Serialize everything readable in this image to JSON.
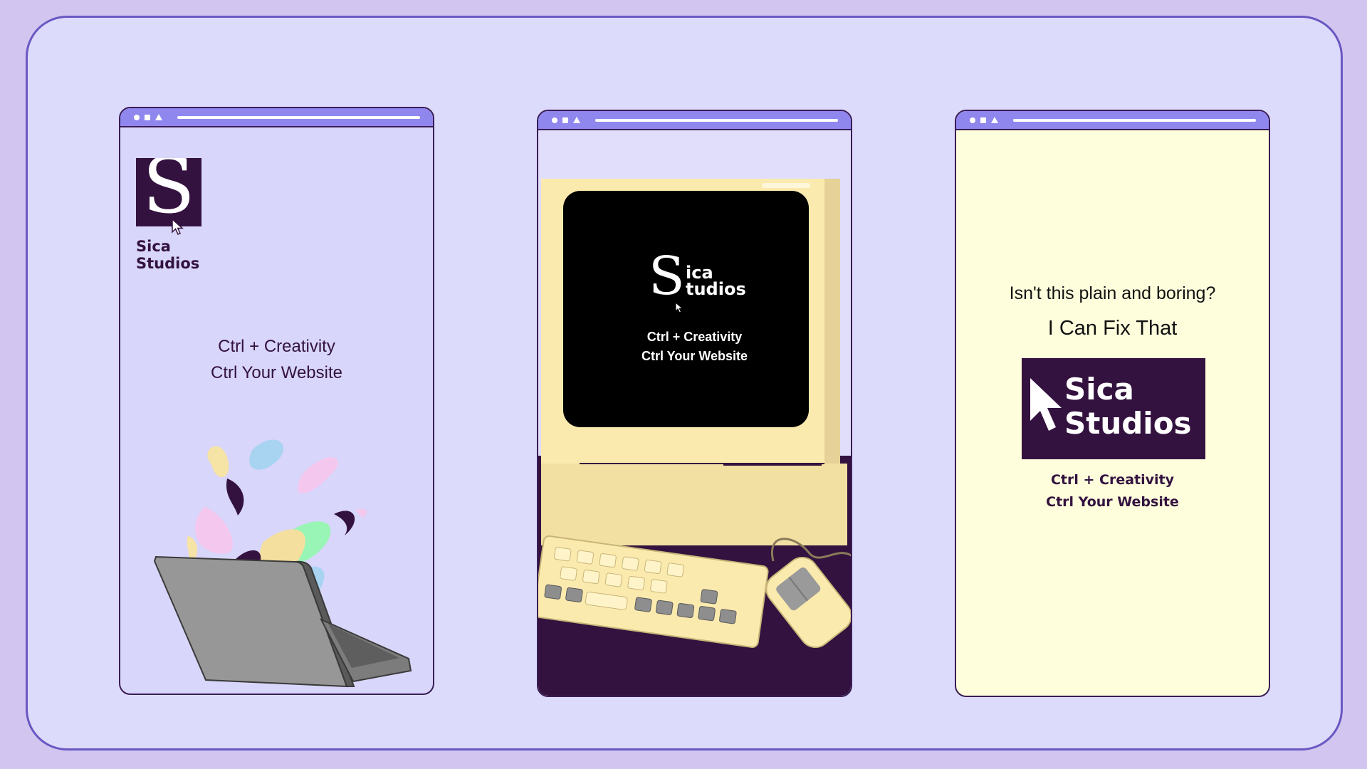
{
  "brand": {
    "monogram": "S",
    "name_line1": "Sica",
    "name_line2": "Studios",
    "screen_name_line1": "ica",
    "screen_name_line2": "tudios"
  },
  "tagline": {
    "line1": "Ctrl + Creativity",
    "line2": "Ctrl Your Website"
  },
  "panel3": {
    "question": "Isn't this plain and boring?",
    "answer": "I Can Fix That"
  },
  "colors": {
    "board_bg": "#dddbfc",
    "outer_bg": "#d2c6f0",
    "titlebar": "#8f87ee",
    "brand_purple": "#33123f",
    "retro_beige": "#fbeaae",
    "panel3_bg": "#fefedd"
  }
}
